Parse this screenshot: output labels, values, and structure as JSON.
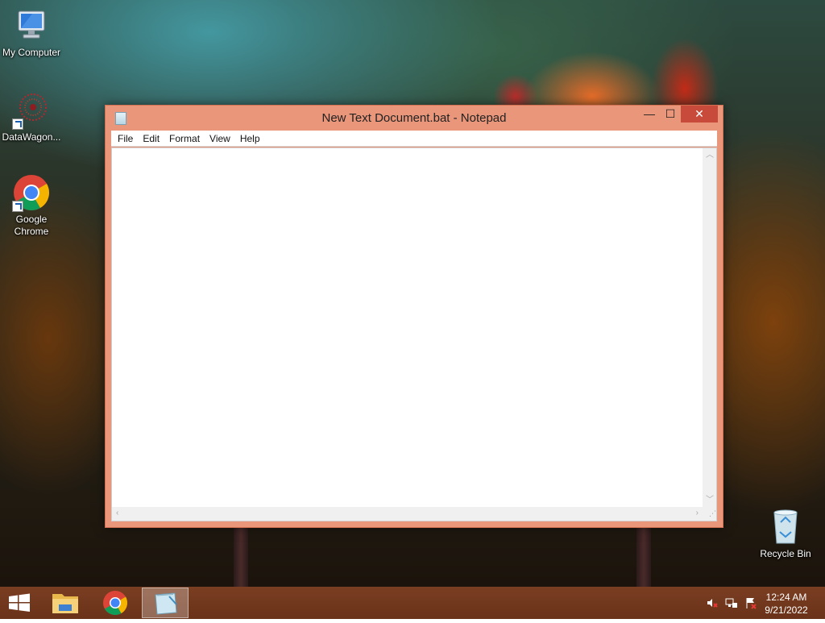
{
  "desktop": {
    "icons": [
      {
        "label": "My Computer"
      },
      {
        "label": "DataWagon..."
      },
      {
        "label": "Google\nChrome"
      },
      {
        "label": "Recycle Bin"
      }
    ]
  },
  "notepad": {
    "title": "New Text Document.bat - Notepad",
    "menu": [
      "File",
      "Edit",
      "Format",
      "View",
      "Help"
    ],
    "content": "",
    "buttons": {
      "minimize": "—",
      "maximize": "☐",
      "close": "✕"
    }
  },
  "taskbar": {
    "apps": [
      {
        "name": "File Explorer",
        "icon": "folder-icon"
      },
      {
        "name": "Google Chrome",
        "icon": "chrome-icon"
      },
      {
        "name": "Notepad",
        "icon": "notepad-icon",
        "active": true
      }
    ],
    "clock": {
      "time": "12:24 AM",
      "date": "9/21/2022"
    }
  },
  "colors": {
    "window_frame": "#e9967a",
    "close_button": "#c74a3a",
    "taskbar": "#6a3219"
  }
}
